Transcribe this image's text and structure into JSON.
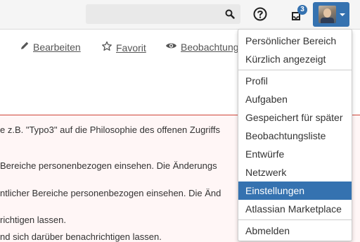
{
  "header": {
    "search": {
      "placeholder": "",
      "value": ""
    },
    "notifications": {
      "count": "3"
    },
    "colors": {
      "accent": "#3572b0",
      "bar_bg": "#f5f5f5"
    }
  },
  "page_actions": [
    {
      "label": "Bearbeiten",
      "icon": "pencil-icon"
    },
    {
      "label": "Favorit",
      "icon": "star-icon"
    },
    {
      "label": "Beobachtung",
      "icon": "eye-icon"
    }
  ],
  "content": {
    "lines": [
      "e z.B. \"Typo3\" auf die Philosophie des offenen Zugriffs",
      "Bereiche personenbezogen einsehen. Die Änderungs",
      "ntlicher Bereiche personenbezogen einsehen. Die Änd",
      "richtigen lassen.",
      "nd sich darüber benachrichtigen lassen."
    ],
    "colors": {
      "bg": "#fff6f6",
      "border": "#d04437"
    }
  },
  "user_menu": {
    "group1": [
      "Persönlicher Bereich",
      "Kürzlich angezeigt"
    ],
    "group2": [
      "Profil",
      "Aufgaben",
      "Gespeichert für später",
      "Beobachtungsliste",
      "Entwürfe",
      "Netzwerk",
      "Einstellungen",
      "Atlassian Marketplace"
    ],
    "group3": [
      "Abmelden"
    ],
    "active_item": "Einstellungen"
  }
}
